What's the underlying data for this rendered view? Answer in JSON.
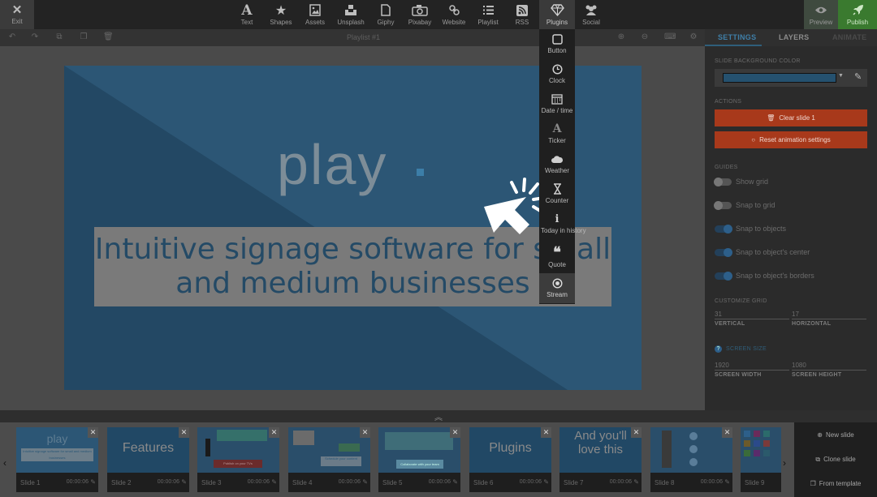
{
  "toolbar": {
    "exit": "Exit",
    "items": [
      {
        "label": "Text",
        "icon": "text-icon"
      },
      {
        "label": "Shapes",
        "icon": "star-icon"
      },
      {
        "label": "Assets",
        "icon": "image-icon"
      },
      {
        "label": "Unsplash",
        "icon": "unsplash-icon"
      },
      {
        "label": "Giphy",
        "icon": "file-icon"
      },
      {
        "label": "Pixabay",
        "icon": "camera-icon"
      },
      {
        "label": "Website",
        "icon": "link-icon"
      },
      {
        "label": "Playlist",
        "icon": "list-icon"
      },
      {
        "label": "RSS",
        "icon": "rss-icon"
      },
      {
        "label": "Plugins",
        "icon": "diamond-icon"
      },
      {
        "label": "Social",
        "icon": "users-icon"
      }
    ],
    "preview": "Preview",
    "publish": "Publish"
  },
  "subbar": {
    "playlist_title": "Playlist #1"
  },
  "canvas": {
    "logo_text": "play",
    "headline": "Intuitive signage software for small and medium businesses"
  },
  "plugins_menu": [
    {
      "label": "Button",
      "icon": "button-icon"
    },
    {
      "label": "Clock",
      "icon": "clock-icon"
    },
    {
      "label": "Date / time",
      "icon": "calendar-icon"
    },
    {
      "label": "Ticker",
      "icon": "ticker-icon"
    },
    {
      "label": "Weather",
      "icon": "cloud-icon"
    },
    {
      "label": "Counter",
      "icon": "hourglass-icon"
    },
    {
      "label": "Today in history",
      "icon": "info-icon"
    },
    {
      "label": "Quote",
      "icon": "quote-icon"
    },
    {
      "label": "Stream",
      "icon": "stream-icon"
    }
  ],
  "panel": {
    "tabs": [
      "SETTINGS",
      "LAYERS",
      "ANIMATE"
    ],
    "bg_color_label": "SLIDE BACKGROUND COLOR",
    "bg_color": "#25516f",
    "actions_label": "ACTIONS",
    "clear_slide": "Clear slide 1",
    "reset_animation": "Reset animation settings",
    "guides_label": "GUIDES",
    "guides": [
      {
        "label": "Show grid",
        "on": false
      },
      {
        "label": "Snap to grid",
        "on": false
      },
      {
        "label": "Snap to objects",
        "on": true
      },
      {
        "label": "Snap to object's center",
        "on": true
      },
      {
        "label": "Snap to object's borders",
        "on": true
      }
    ],
    "customize_grid_label": "CUSTOMIZE GRID",
    "grid_vertical": "31",
    "grid_vertical_cap": "VERTICAL",
    "grid_horizontal": "17",
    "grid_horizontal_cap": "HORIZONTAL",
    "screen_size_label": "SCREEN SIZE",
    "screen_width": "1920",
    "screen_width_cap": "SCREEN WIDTH",
    "screen_height": "1080",
    "screen_height_cap": "SCREEN HEIGHT"
  },
  "slides": [
    {
      "name": "Slide 1",
      "duration": "00:00:06",
      "title": "play",
      "sub": "Intuitive signage software for small and medium businesses"
    },
    {
      "name": "Slide 2",
      "duration": "00:00:06",
      "title": "Features"
    },
    {
      "name": "Slide 3",
      "duration": "00:00:06",
      "sub": "Publish on your TVs"
    },
    {
      "name": "Slide 4",
      "duration": "00:00:06",
      "sub": "Schedule your content"
    },
    {
      "name": "Slide 5",
      "duration": "00:00:06",
      "sub": "Collaborate with your team"
    },
    {
      "name": "Slide 6",
      "duration": "00:00:06",
      "title": "Plugins"
    },
    {
      "name": "Slide 7",
      "duration": "00:00:06",
      "title": "And you'll love this"
    },
    {
      "name": "Slide 8",
      "duration": "00:00:06"
    },
    {
      "name": "Slide 9",
      "duration": ""
    }
  ],
  "film_actions": {
    "new_slide": "New slide",
    "clone_slide": "Clone slide",
    "from_template": "From template"
  }
}
